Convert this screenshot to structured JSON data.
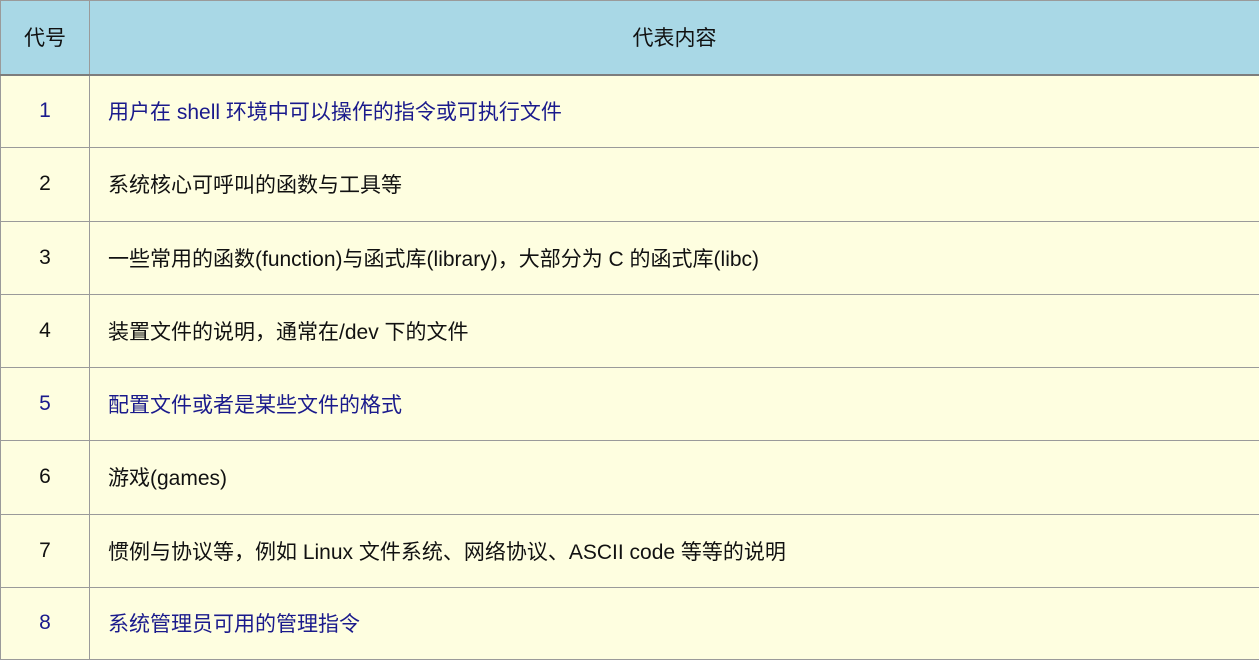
{
  "header": {
    "code_label": "代号",
    "content_label": "代表内容"
  },
  "colors": {
    "header_background": "#a9d8e6",
    "row_background": "#fefee0",
    "border": "#9a9a9a",
    "highlight_text": "#1a1a8c",
    "normal_text": "#111111"
  },
  "rows": [
    {
      "code": "1",
      "description": "用户在 shell 环境中可以操作的指令或可执行文件",
      "highlight": true
    },
    {
      "code": "2",
      "description": "系统核心可呼叫的函数与工具等",
      "highlight": false
    },
    {
      "code": "3",
      "description": "一些常用的函数(function)与函式库(library)，大部分为 C 的函式库(libc)",
      "highlight": false
    },
    {
      "code": "4",
      "description": "装置文件的说明，通常在/dev 下的文件",
      "highlight": false
    },
    {
      "code": "5",
      "description": "配置文件或者是某些文件的格式",
      "highlight": true
    },
    {
      "code": "6",
      "description": "游戏(games)",
      "highlight": false
    },
    {
      "code": "7",
      "description": "惯例与协议等，例如 Linux 文件系统、网络协议、ASCII code 等等的说明",
      "highlight": false
    },
    {
      "code": "8",
      "description": "系统管理员可用的管理指令",
      "highlight": true
    }
  ]
}
